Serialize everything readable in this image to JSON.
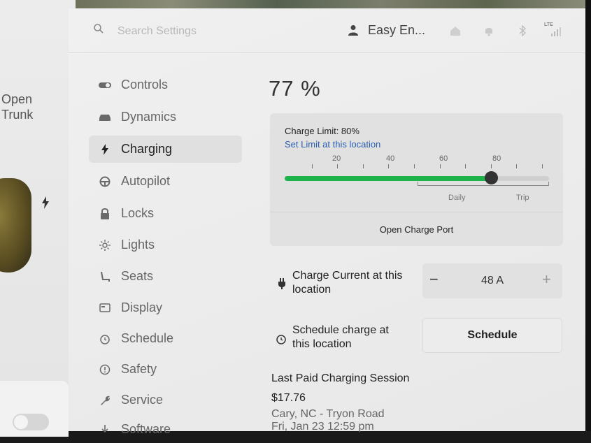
{
  "car_panel": {
    "open_trunk_line1": "Open",
    "open_trunk_line2": "Trunk"
  },
  "header": {
    "search_placeholder": "Search Settings",
    "user_name": "Easy En...",
    "network_label": "LTE"
  },
  "nav": {
    "items": [
      {
        "label": "Controls",
        "icon": "toggle-icon"
      },
      {
        "label": "Dynamics",
        "icon": "car-icon"
      },
      {
        "label": "Charging",
        "icon": "lightning-icon",
        "active": true
      },
      {
        "label": "Autopilot",
        "icon": "steering-wheel-icon"
      },
      {
        "label": "Locks",
        "icon": "lock-icon"
      },
      {
        "label": "Lights",
        "icon": "sun-icon"
      },
      {
        "label": "Seats",
        "icon": "seat-icon"
      },
      {
        "label": "Display",
        "icon": "display-icon"
      },
      {
        "label": "Schedule",
        "icon": "alarm-clock-icon"
      },
      {
        "label": "Safety",
        "icon": "alert-circle-icon"
      },
      {
        "label": "Service",
        "icon": "wrench-icon"
      },
      {
        "label": "Software",
        "icon": "download-icon"
      }
    ]
  },
  "charging": {
    "battery_percent": "77 %",
    "charge_limit_label": "Charge Limit: 80%",
    "charge_limit_value": 80,
    "current_charge_value": 77,
    "set_limit_link": "Set Limit at this location",
    "slider_ticks": [
      "20",
      "40",
      "60",
      "80"
    ],
    "range_daily": "Daily",
    "range_trip": "Trip",
    "open_port_label": "Open Charge Port",
    "current_label_line1": "Charge Current at this",
    "current_label_line2": "location",
    "current_minus": "−",
    "current_value": "48 A",
    "current_plus": "+",
    "schedule_label_line1": "Schedule charge at",
    "schedule_label_line2": "this location",
    "schedule_button": "Schedule",
    "last_session_title": "Last Paid Charging Session",
    "last_session_amount": "$17.76",
    "last_session_location": "Cary, NC - Tryon Road",
    "last_session_date": "Fri, Jan 23 12:59 pm"
  },
  "colors": {
    "accent_green": "#1db34a",
    "link_blue": "#2a5db0"
  }
}
